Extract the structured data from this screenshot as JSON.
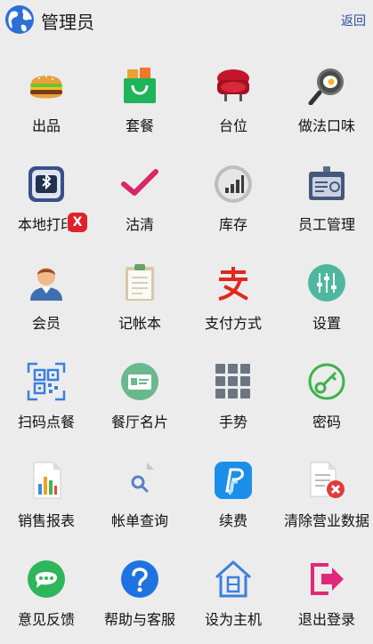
{
  "header": {
    "title": "管理员",
    "back_label": "返回"
  },
  "items": [
    {
      "label": "出品",
      "icon": "hamburger-icon"
    },
    {
      "label": "套餐",
      "icon": "shopping-bag-icon"
    },
    {
      "label": "台位",
      "icon": "armchair-icon"
    },
    {
      "label": "做法口味",
      "icon": "frying-pan-icon"
    },
    {
      "label": "本地打印",
      "icon": "bluetooth-printer-icon"
    },
    {
      "label": "沽清",
      "icon": "checkmark-icon"
    },
    {
      "label": "库存",
      "icon": "bar-chart-icon"
    },
    {
      "label": "员工管理",
      "icon": "id-badge-icon"
    },
    {
      "label": "会员",
      "icon": "person-icon"
    },
    {
      "label": "记帐本",
      "icon": "clipboard-icon"
    },
    {
      "label": "支付方式",
      "icon": "alipay-icon"
    },
    {
      "label": "设置",
      "icon": "sliders-icon"
    },
    {
      "label": "扫码点餐",
      "icon": "qr-code-icon"
    },
    {
      "label": "餐厅名片",
      "icon": "business-card-icon"
    },
    {
      "label": "手势",
      "icon": "grid-dots-icon"
    },
    {
      "label": "密码",
      "icon": "key-icon"
    },
    {
      "label": "销售报表",
      "icon": "report-icon"
    },
    {
      "label": "帐单查询",
      "icon": "search-document-icon"
    },
    {
      "label": "续费",
      "icon": "paypal-icon"
    },
    {
      "label": "清除营业数据",
      "icon": "delete-document-icon"
    },
    {
      "label": "意见反馈",
      "icon": "chat-bubble-icon"
    },
    {
      "label": "帮助与客服",
      "icon": "help-icon"
    },
    {
      "label": "设为主机",
      "icon": "house-icon"
    },
    {
      "label": "退出登录",
      "icon": "logout-icon"
    }
  ],
  "badge": {
    "text": "X"
  }
}
